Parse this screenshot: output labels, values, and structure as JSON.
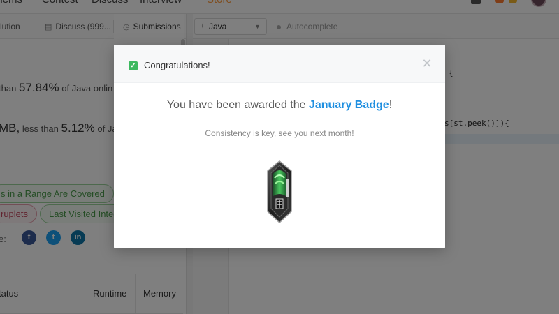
{
  "topnav": {
    "links": [
      "blems",
      "Contest",
      "Discuss",
      "Interview",
      "Store"
    ]
  },
  "left_tabs": [
    {
      "label": "lution"
    },
    {
      "label": "Discuss (999..."
    },
    {
      "label": "Submissions"
    }
  ],
  "stats": {
    "runtime_prefix": "than",
    "runtime_pct": "57.84%",
    "runtime_suffix": "of Java onlin",
    "memory_prefix": "MB,",
    "memory_mid": "less than",
    "memory_pct": "5.12%",
    "memory_suffix": "of Java"
  },
  "tags": [
    {
      "label": "s in a Range Are Covered",
      "color": "green"
    },
    {
      "label": "ruplets",
      "color": "red"
    },
    {
      "label": "Last Visited Integ",
      "color": "green"
    }
  ],
  "share_label": "e:",
  "social_icons": [
    "facebook-icon",
    "twitter-icon",
    "linkedin-icon"
  ],
  "table": {
    "headers": [
      "tatus",
      "Runtime",
      "Memory"
    ]
  },
  "editor": {
    "language": "Java",
    "autocomplete_label": "Autocomplete",
    "code_lines": [
      "{",
      "s[st.peek()]){"
    ]
  },
  "modal": {
    "title": "Congratulations!",
    "headline_prefix": "You have been awarded the",
    "badge_name": "January Badge",
    "headline_suffix": "!",
    "subtitle": "Consistency is key, see you next month!",
    "close_icon": "close-icon",
    "check_color": "#3cb95f",
    "badge_link_color": "#1f8fe0"
  }
}
